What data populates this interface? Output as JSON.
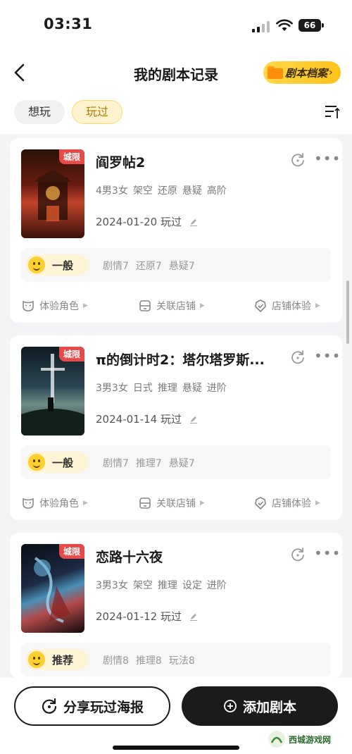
{
  "status": {
    "time": "03:31",
    "battery": "66"
  },
  "nav": {
    "title": "我的剧本记录",
    "archive_label": "剧本档案"
  },
  "tabs": [
    {
      "label": "想玩"
    },
    {
      "label": "玩过"
    }
  ],
  "cards": [
    {
      "title": "阎罗帖2",
      "tag": "城限",
      "meta": [
        "4男3女",
        "架空",
        "还原",
        "悬疑",
        "高阶"
      ],
      "date": "2024-01-20 玩过",
      "rating": "一般",
      "scores": [
        "剧情7",
        "还原7",
        "悬疑7"
      ]
    },
    {
      "title": "π的倒计时2：塔尔塔罗斯...",
      "tag": "城限",
      "meta": [
        "3男3女",
        "日式",
        "推理",
        "悬疑",
        "进阶"
      ],
      "date": "2024-01-14 玩过",
      "rating": "一般",
      "scores": [
        "剧情7",
        "推理7",
        "悬疑7"
      ]
    },
    {
      "title": "恋路十六夜",
      "tag": "城限",
      "meta": [
        "3男3女",
        "架空",
        "推理",
        "设定",
        "进阶"
      ],
      "date": "2024-01-12 玩过",
      "rating": "推荐",
      "scores": [
        "剧情8",
        "推理8",
        "玩法8"
      ]
    }
  ],
  "actions": {
    "role": "体验角色",
    "shop": "关联店铺",
    "exp": "店铺体验"
  },
  "bottom": {
    "share": "分享玩过海报",
    "add": "添加剧本"
  },
  "watermark": "西城游戏网"
}
